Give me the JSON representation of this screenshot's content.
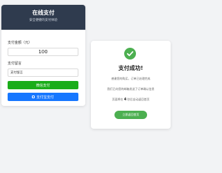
{
  "colors": {
    "header_bg": "#2f3b4e",
    "wechat_green": "#1aad19",
    "alipay_blue": "#1677ff",
    "success_green": "#4caf50",
    "page_bg": "#f2f3f5"
  },
  "payment": {
    "title": "在线支付",
    "subtitle": "安全便捷的支付体验",
    "amount_label": "支付金额（元）",
    "amount_value": "100",
    "note_label": "支付留言",
    "note_placeholder": "支付留言",
    "wechat_button": "微信支付",
    "alipay_button": "支付宝支付",
    "alipay_icon": "wallet-icon"
  },
  "success": {
    "icon": "check-icon",
    "title": "支付成功!",
    "message_1": "感谢您的购买，订单已处理完成",
    "message_2": "我们已向您的邮箱发送了订单确认信息",
    "countdown_prefix": "页面将在",
    "countdown_value": "4",
    "countdown_suffix": "秒后自动返回首页",
    "home_button": "立即返回首页"
  }
}
